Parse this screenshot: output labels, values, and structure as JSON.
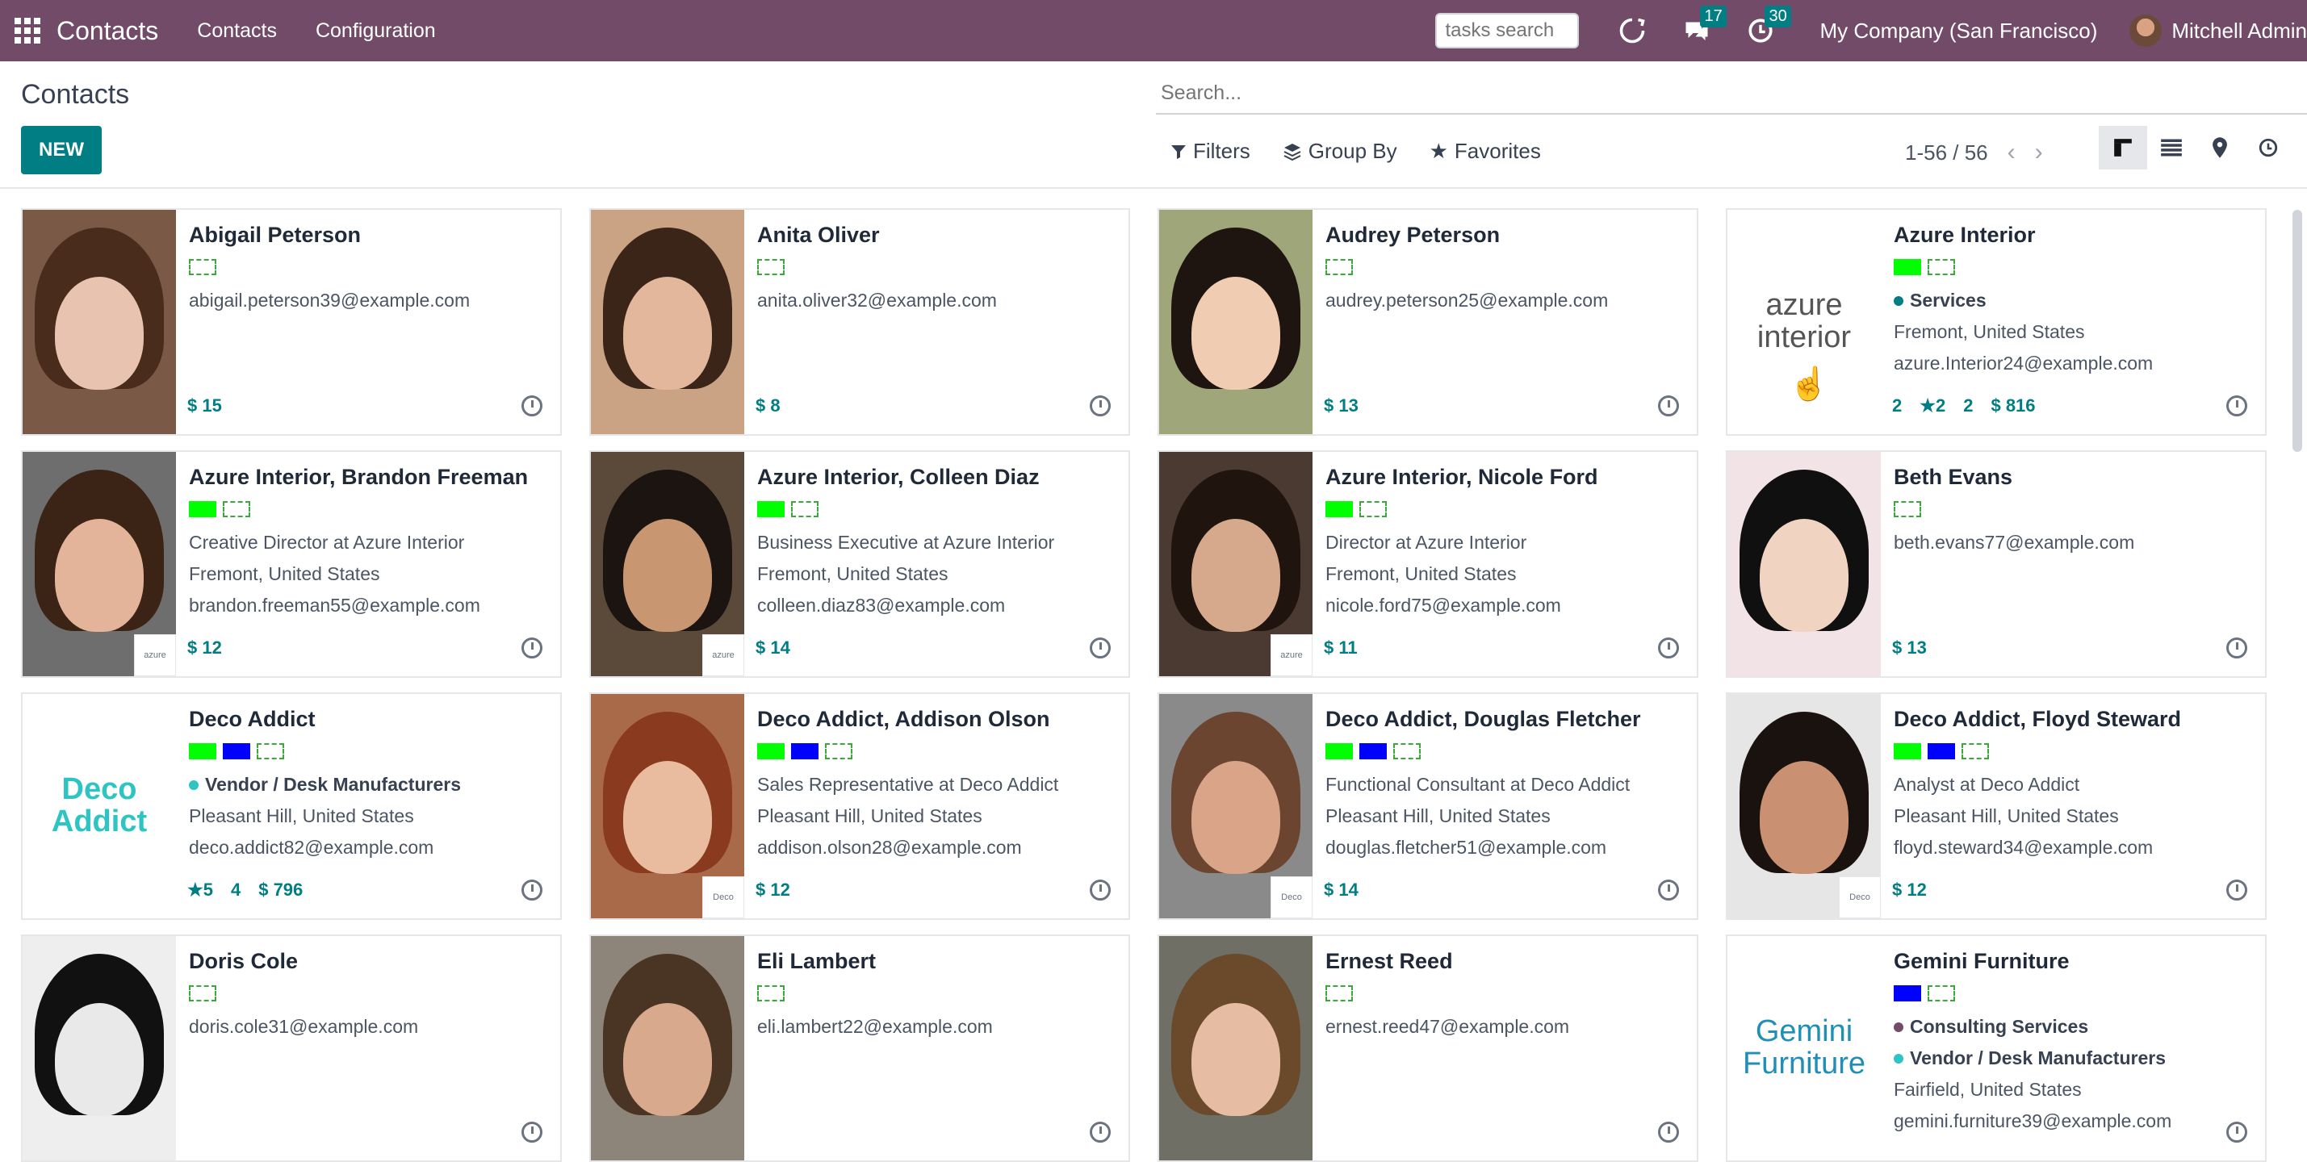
{
  "nav": {
    "app_title": "Contacts",
    "menu": [
      "Contacts",
      "Configuration"
    ],
    "tasks_placeholder": "tasks search",
    "messages_badge": "17",
    "activities_badge": "30",
    "company": "My Company (San Francisco)",
    "user": "Mitchell Admin"
  },
  "control": {
    "title": "Contacts",
    "new_label": "NEW",
    "search_placeholder": "Search...",
    "filters": "Filters",
    "group_by": "Group By",
    "favorites": "Favorites",
    "pager": "1-56 / 56"
  },
  "cards": [
    {
      "name": "Abigail Peterson",
      "tags": [
        "empty"
      ],
      "lines": [
        "abigail.peterson39@example.com"
      ],
      "footer": [
        "$ 15"
      ],
      "photo": {
        "bg": "#7a5a46",
        "face": "#e8c4b0",
        "hair": "#4a2c1c"
      }
    },
    {
      "name": "Anita Oliver",
      "tags": [
        "empty"
      ],
      "lines": [
        "anita.oliver32@example.com"
      ],
      "footer": [
        "$ 8"
      ],
      "photo": {
        "bg": "#c9a384",
        "face": "#e2b79b",
        "hair": "#3b2518"
      }
    },
    {
      "name": "Audrey Peterson",
      "tags": [
        "empty"
      ],
      "lines": [
        "audrey.peterson25@example.com"
      ],
      "footer": [
        "$ 13"
      ],
      "photo": {
        "bg": "#9fa679",
        "face": "#f0cdb2",
        "hair": "#1e1410"
      }
    },
    {
      "name": "Azure Interior",
      "tags": [
        "green",
        "empty"
      ],
      "category": [
        {
          "label": "Services",
          "color": "#017e84"
        }
      ],
      "lines": [
        "Fremont, United States",
        "azure.Interior24@example.com"
      ],
      "footer": [
        "2",
        "★2",
        "2",
        "$ 816"
      ],
      "logo": "azure\ninterior"
    },
    {
      "name": "Azure Interior, Brandon Freeman",
      "tags": [
        "green",
        "empty"
      ],
      "lines": [
        "Creative Director at Azure Interior",
        "Fremont, United States",
        "brandon.freeman55@example.com"
      ],
      "footer": [
        "$ 12"
      ],
      "photo": {
        "bg": "#6e6e6e",
        "face": "#e3b49a",
        "hair": "#3b2416"
      },
      "mini": "azure"
    },
    {
      "name": "Azure Interior, Colleen Diaz",
      "tags": [
        "green",
        "empty"
      ],
      "lines": [
        "Business Executive at Azure Interior",
        "Fremont, United States",
        "colleen.diaz83@example.com"
      ],
      "footer": [
        "$ 14"
      ],
      "photo": {
        "bg": "#5b4a3a",
        "face": "#c99672",
        "hair": "#1c1410"
      },
      "mini": "azure"
    },
    {
      "name": "Azure Interior, Nicole Ford",
      "tags": [
        "green",
        "empty"
      ],
      "lines": [
        "Director at Azure Interior",
        "Fremont, United States",
        "nicole.ford75@example.com"
      ],
      "footer": [
        "$ 11"
      ],
      "photo": {
        "bg": "#4a3a32",
        "face": "#d7a98c",
        "hair": "#20140e"
      },
      "mini": "azure"
    },
    {
      "name": "Beth Evans",
      "tags": [
        "empty"
      ],
      "lines": [
        "beth.evans77@example.com"
      ],
      "footer": [
        "$ 13"
      ],
      "photo": {
        "bg": "#f2e4e6",
        "face": "#f1d3c2",
        "hair": "#101010"
      }
    },
    {
      "name": "Deco Addict",
      "tags": [
        "green",
        "blue",
        "empty"
      ],
      "category": [
        {
          "label": "Vendor / Desk Manufacturers",
          "color": "#2ec4c4"
        }
      ],
      "lines": [
        "Pleasant Hill, United States",
        "deco.addict82@example.com"
      ],
      "footer": [
        "★5",
        "4",
        "$ 796"
      ],
      "logo": "Deco\nAddict"
    },
    {
      "name": "Deco Addict, Addison Olson",
      "tags": [
        "green",
        "blue",
        "empty"
      ],
      "lines": [
        "Sales Representative at Deco Addict",
        "Pleasant Hill, United States",
        "addison.olson28@example.com"
      ],
      "footer": [
        "$ 12"
      ],
      "photo": {
        "bg": "#a86a48",
        "face": "#eabc9f",
        "hair": "#8a3a1e"
      },
      "mini": "Deco"
    },
    {
      "name": "Deco Addict, Douglas Fletcher",
      "tags": [
        "green",
        "blue",
        "empty"
      ],
      "lines": [
        "Functional Consultant at Deco Addict",
        "Pleasant Hill, United States",
        "douglas.fletcher51@example.com"
      ],
      "footer": [
        "$ 14"
      ],
      "photo": {
        "bg": "#8a8a8a",
        "face": "#d9a488",
        "hair": "#6b4530"
      },
      "mini": "Deco"
    },
    {
      "name": "Deco Addict, Floyd Steward",
      "tags": [
        "green",
        "blue",
        "empty"
      ],
      "lines": [
        "Analyst at Deco Addict",
        "Pleasant Hill, United States",
        "floyd.steward34@example.com"
      ],
      "footer": [
        "$ 12"
      ],
      "photo": {
        "bg": "#e6e6e6",
        "face": "#c99072",
        "hair": "#1a120e"
      },
      "mini": "Deco"
    },
    {
      "name": "Doris Cole",
      "tags": [
        "empty"
      ],
      "lines": [
        "doris.cole31@example.com"
      ],
      "footer": [],
      "photo": {
        "bg": "#eeeeee",
        "face": "#e9e9e9",
        "hair": "#111111"
      }
    },
    {
      "name": "Eli Lambert",
      "tags": [
        "empty"
      ],
      "lines": [
        "eli.lambert22@example.com"
      ],
      "footer": [],
      "photo": {
        "bg": "#8d857a",
        "face": "#d8a98c",
        "hair": "#4a3424"
      }
    },
    {
      "name": "Ernest Reed",
      "tags": [
        "empty"
      ],
      "lines": [
        "ernest.reed47@example.com"
      ],
      "footer": [],
      "photo": {
        "bg": "#6f6f66",
        "face": "#e6bda3",
        "hair": "#6b4a2c"
      }
    },
    {
      "name": "Gemini Furniture",
      "tags": [
        "blue",
        "empty"
      ],
      "category": [
        {
          "label": "Consulting Services",
          "color": "#714b67"
        },
        {
          "label": "Vendor / Desk Manufacturers",
          "color": "#2ec4c4"
        }
      ],
      "lines": [
        "Fairfield, United States",
        "gemini.furniture39@example.com"
      ],
      "footer": [],
      "logo": "Gemini\nFurniture"
    }
  ]
}
